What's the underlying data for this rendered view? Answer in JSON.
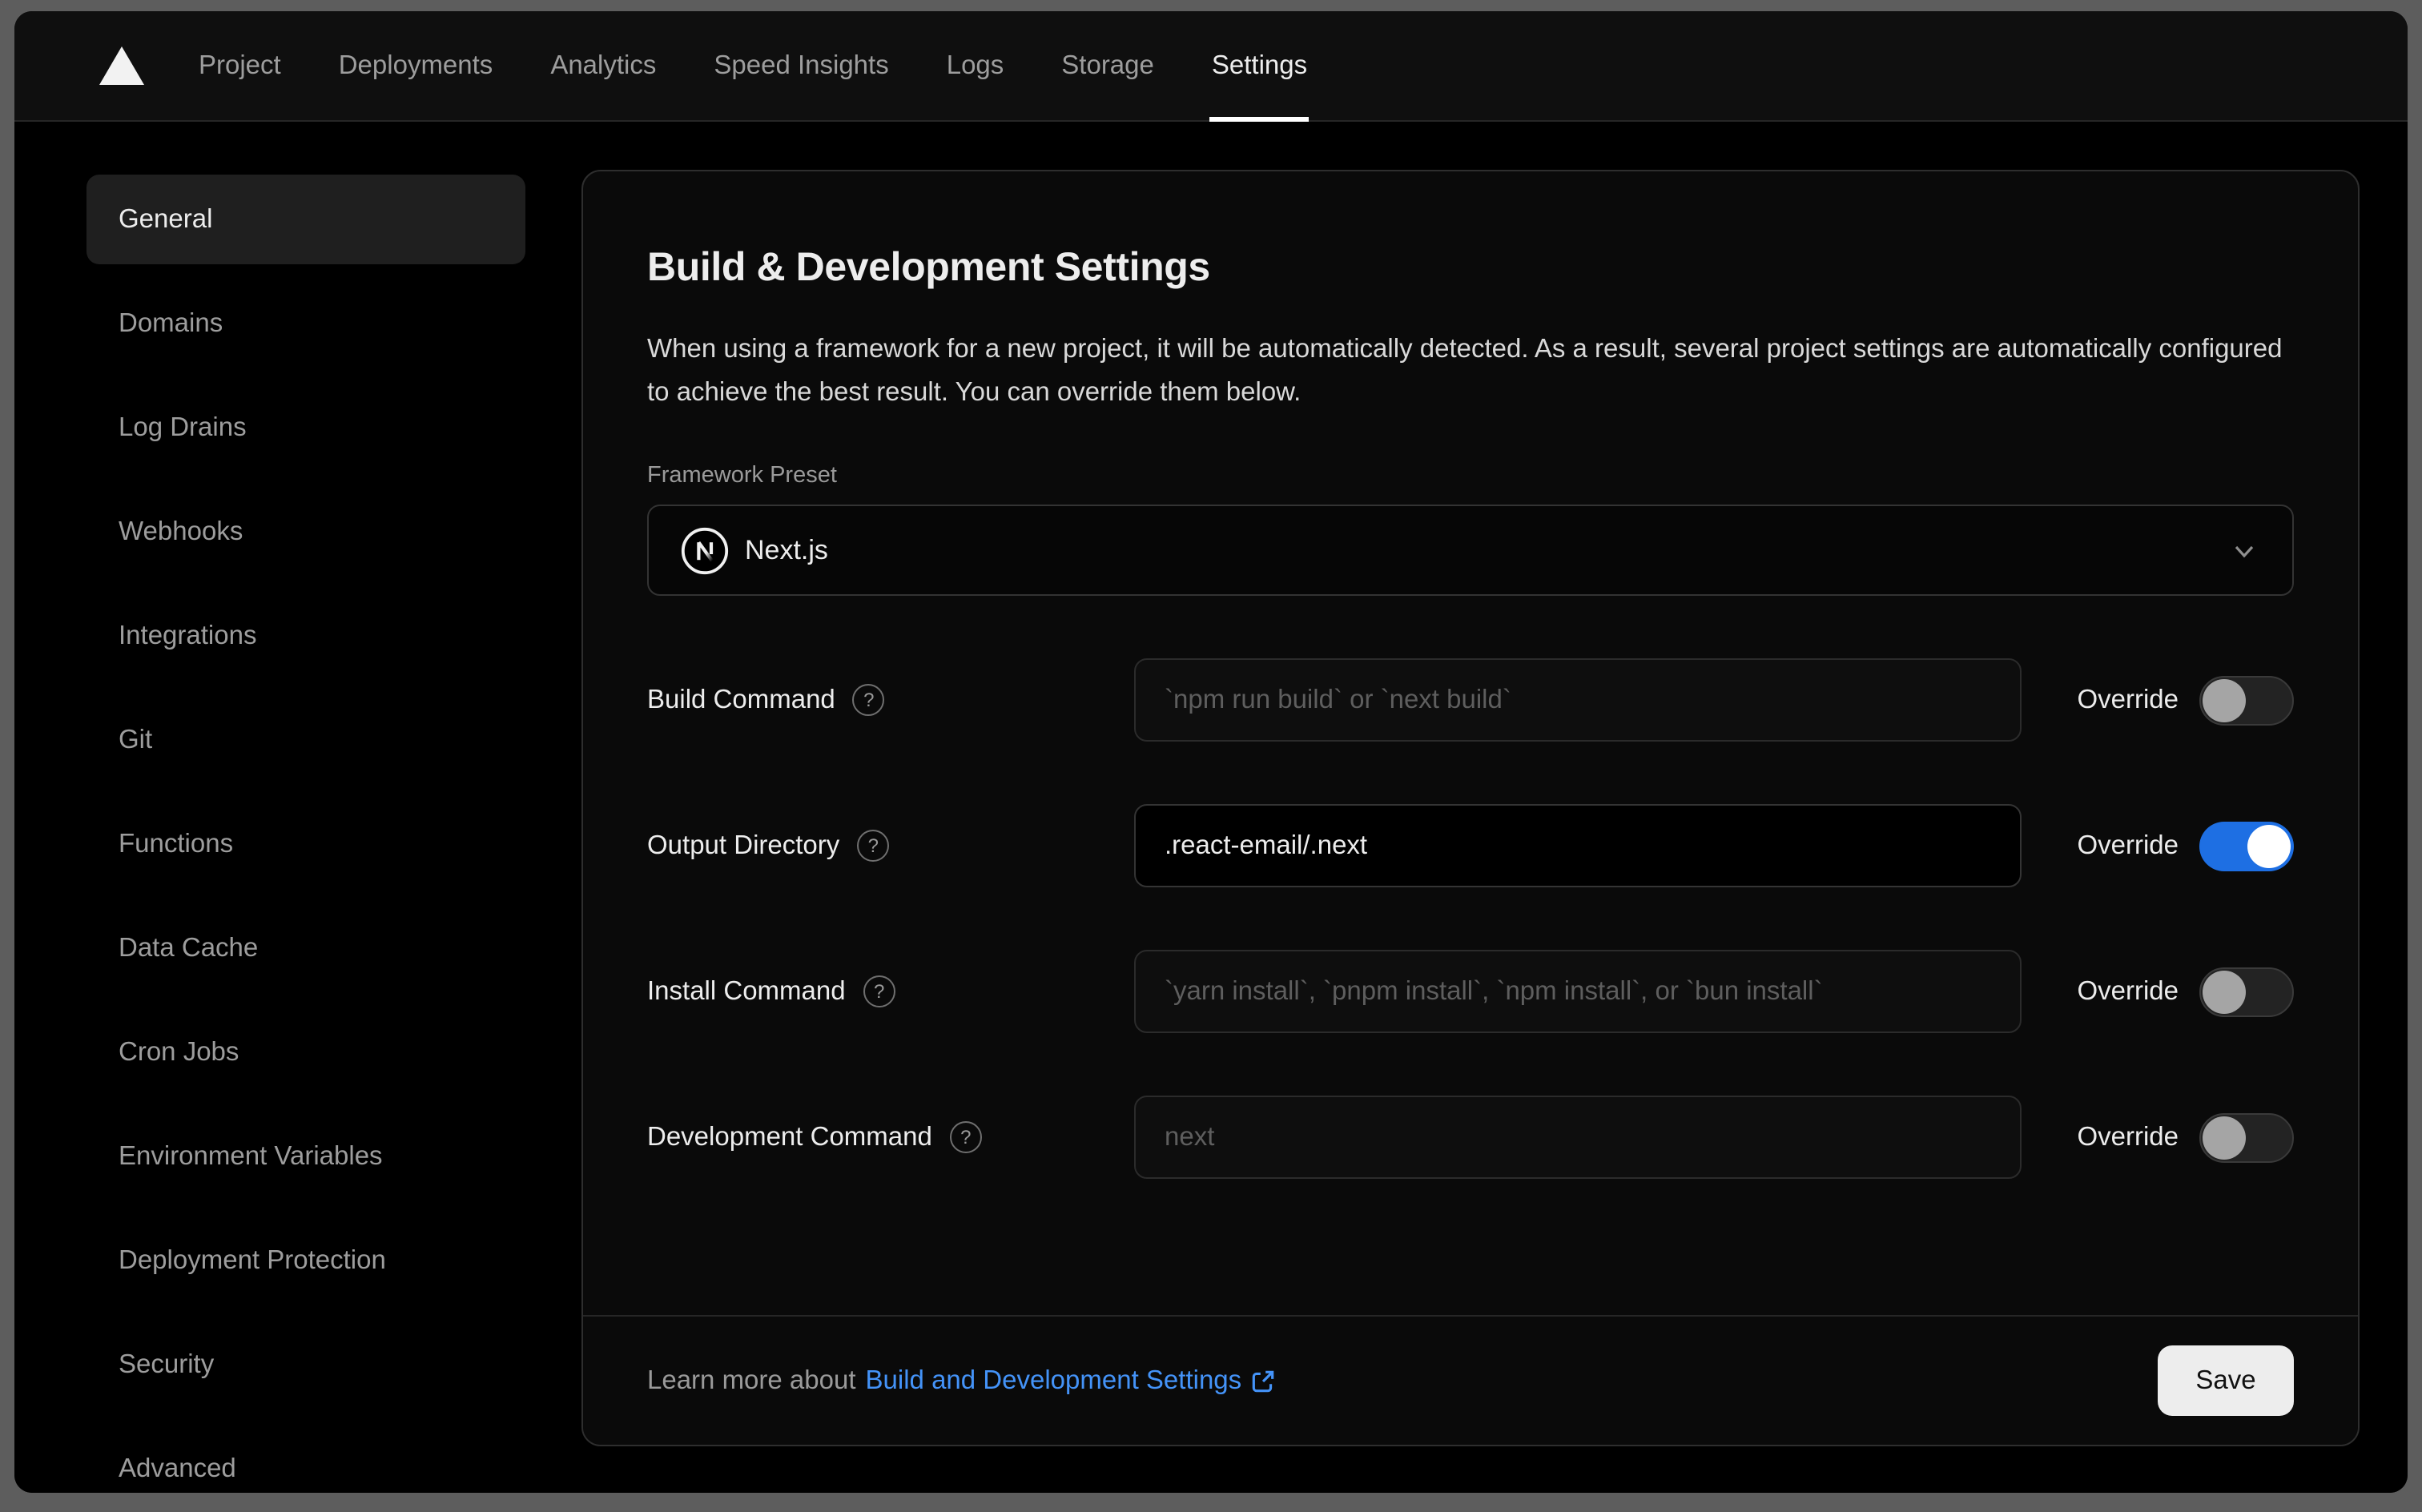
{
  "nav": {
    "logo": "vercel-logo",
    "items": [
      {
        "label": "Project",
        "active": false
      },
      {
        "label": "Deployments",
        "active": false
      },
      {
        "label": "Analytics",
        "active": false
      },
      {
        "label": "Speed Insights",
        "active": false
      },
      {
        "label": "Logs",
        "active": false
      },
      {
        "label": "Storage",
        "active": false
      },
      {
        "label": "Settings",
        "active": true
      }
    ]
  },
  "sidebar": {
    "items": [
      {
        "label": "General",
        "active": true
      },
      {
        "label": "Domains",
        "active": false
      },
      {
        "label": "Log Drains",
        "active": false
      },
      {
        "label": "Webhooks",
        "active": false
      },
      {
        "label": "Integrations",
        "active": false
      },
      {
        "label": "Git",
        "active": false
      },
      {
        "label": "Functions",
        "active": false
      },
      {
        "label": "Data Cache",
        "active": false
      },
      {
        "label": "Cron Jobs",
        "active": false
      },
      {
        "label": "Environment Variables",
        "active": false
      },
      {
        "label": "Deployment Protection",
        "active": false
      },
      {
        "label": "Security",
        "active": false
      },
      {
        "label": "Advanced",
        "active": false
      }
    ]
  },
  "panel": {
    "title": "Build & Development Settings",
    "description": "When using a framework for a new project, it will be automatically detected. As a result, several project settings are automatically configured to achieve the best result. You can override them below.",
    "framework_preset": {
      "label": "Framework Preset",
      "value": "Next.js"
    },
    "override_label": "Override",
    "help_glyph": "?",
    "rows": [
      {
        "label": "Build Command",
        "placeholder": "`npm run build` or `next build`",
        "value": "",
        "override": false
      },
      {
        "label": "Output Directory",
        "placeholder": "",
        "value": ".react-email/.next",
        "override": true
      },
      {
        "label": "Install Command",
        "placeholder": "`yarn install`, `pnpm install`, `npm install`, or `bun install`",
        "value": "",
        "override": false
      },
      {
        "label": "Development Command",
        "placeholder": "next",
        "value": "",
        "override": false
      }
    ],
    "footer": {
      "learn_more_prefix": "Learn more about",
      "link_text": "Build and Development Settings",
      "save_label": "Save"
    }
  },
  "colors": {
    "toggle_on_blue": "#1e6fe3",
    "link_blue": "#4493f8",
    "save_button_bg": "#ededed",
    "window_frame": "#5d5d5d",
    "card_border": "#2e2e2e"
  }
}
